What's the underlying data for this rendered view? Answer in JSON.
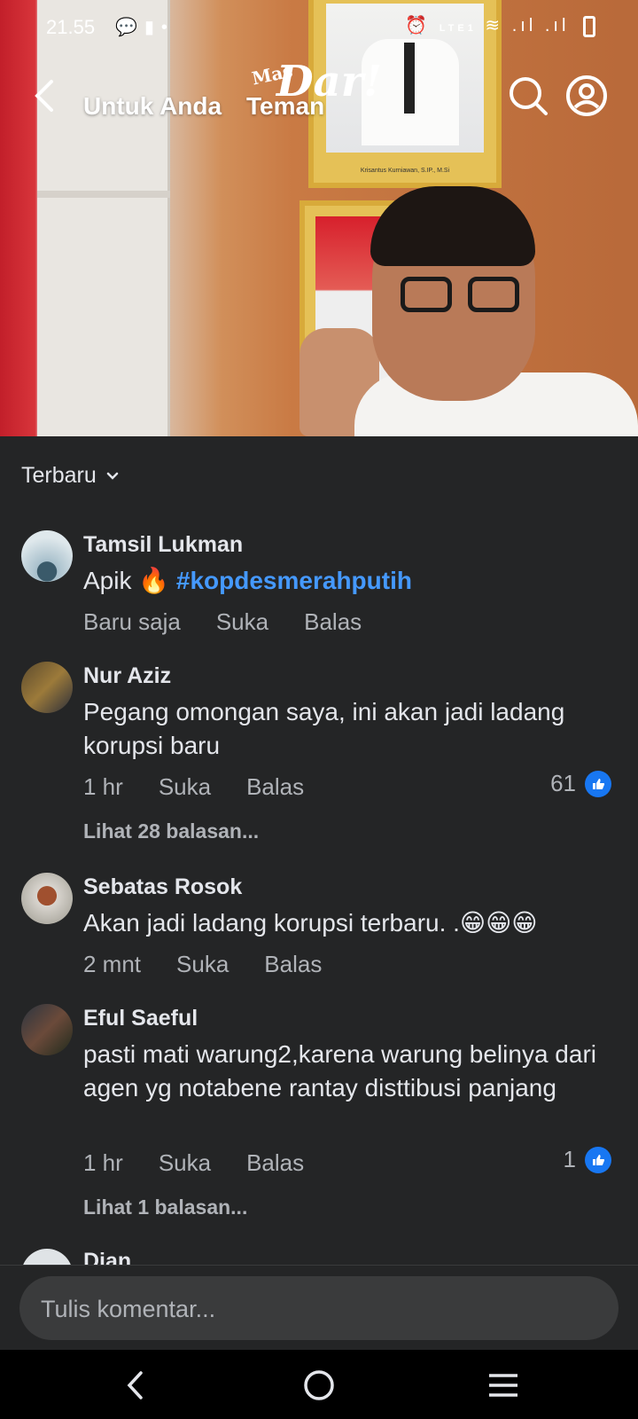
{
  "status_bar": {
    "time": "21.55",
    "notification_icons": [
      "message-icon",
      "alert-icon",
      "dot-icon"
    ],
    "network_label": "LTE1"
  },
  "header": {
    "tabs": [
      {
        "label": "Untuk Anda"
      },
      {
        "label": "Teman"
      }
    ],
    "logo": {
      "prefix": "Mas",
      "name": "Dar!"
    }
  },
  "video": {
    "portrait_caption": "Krisantus Kurniawan, S.IP., M.Si"
  },
  "comments_sort": {
    "label": "Terbaru"
  },
  "comments": [
    {
      "author": "Tamsil Lukman",
      "text": "Apik 🔥",
      "hashtag": "#kopdesmerahputih",
      "time": "Baru saja",
      "like_label": "Suka",
      "reply_label": "Balas"
    },
    {
      "author": "Nur Aziz",
      "text": "Pegang omongan saya, ini akan jadi ladang korupsi baru",
      "time": "1 hr",
      "like_label": "Suka",
      "reply_label": "Balas",
      "like_count": "61",
      "replies_link": "Lihat 28 balasan..."
    },
    {
      "author": "Sebatas Rosok",
      "text": "Akan jadi ladang korupsi terbaru. .😁😁😁",
      "time": "2 mnt",
      "like_label": "Suka",
      "reply_label": "Balas"
    },
    {
      "author": "Eful Saeful",
      "text": "pasti mati warung2,karena warung belinya dari agen yg notabene rantay disttibusi panjang",
      "time": "1 hr",
      "like_label": "Suka",
      "reply_label": "Balas",
      "like_count": "1",
      "replies_link": "Lihat 1 balasan..."
    },
    {
      "author": "Dian"
    }
  ],
  "composer": {
    "placeholder": "Tulis komentar..."
  },
  "colors": {
    "background": "#242526",
    "text": "#e4e6eb",
    "secondary_text": "#b0b3b8",
    "hashtag": "#4599ff",
    "like_blue": "#1877f2"
  }
}
